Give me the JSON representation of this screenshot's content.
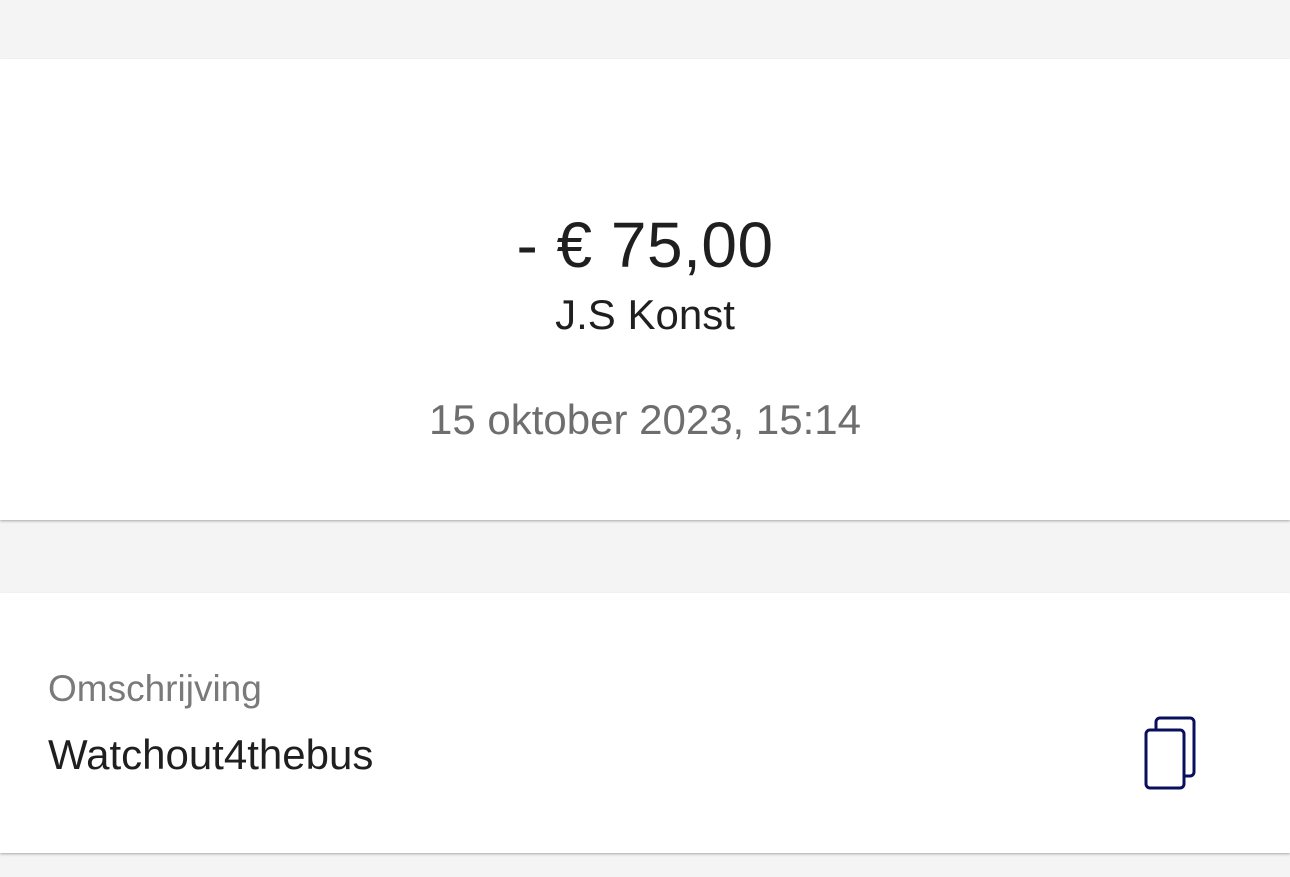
{
  "transaction": {
    "amount": "- € 75,00",
    "counterparty": "J.S Konst",
    "datetime": "15 oktober 2023, 15:14"
  },
  "description": {
    "label": "Omschrijving",
    "value": "Watchout4thebus",
    "copy_icon": "copy-icon"
  },
  "colors": {
    "background": "#f4f4f4",
    "card": "#ffffff",
    "text_primary": "#1f1f1f",
    "text_secondary": "#6e6e6e",
    "icon_accent": "#0a0f5c"
  }
}
